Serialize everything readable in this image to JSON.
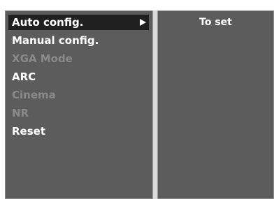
{
  "menu": {
    "items": [
      {
        "label": "Auto config.",
        "state": "selected"
      },
      {
        "label": "Manual config.",
        "state": "enabled"
      },
      {
        "label": "XGA Mode",
        "state": "disabled"
      },
      {
        "label": "ARC",
        "state": "enabled"
      },
      {
        "label": "Cinema",
        "state": "disabled"
      },
      {
        "label": "NR",
        "state": "disabled"
      },
      {
        "label": "Reset",
        "state": "enabled"
      }
    ],
    "selected_icon": "arrow-right-icon"
  },
  "submenu": {
    "value": "To set"
  }
}
